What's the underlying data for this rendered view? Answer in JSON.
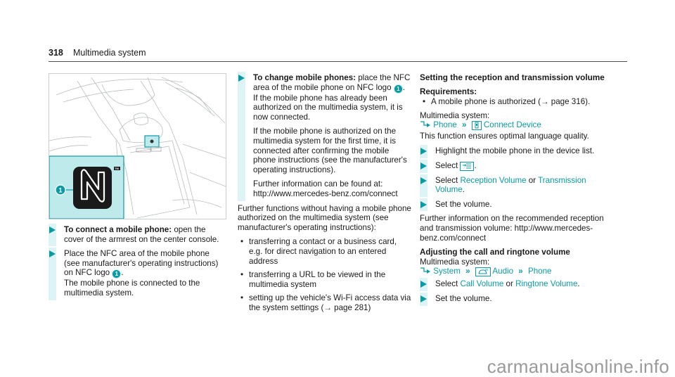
{
  "header": {
    "page_number": "318",
    "section_title": "Multimedia system"
  },
  "figure": {
    "callout_number": "1",
    "trademark": "TM",
    "logo_label": "NFC logo"
  },
  "col1": {
    "step1": {
      "bold": "To connect a mobile phone:",
      "text": " open the cover of the armrest on the center console."
    },
    "step2": {
      "text_a": "Place the NFC area of the mobile phone (see manufacturer's operating instructions) on NFC logo ",
      "callout": "1",
      "text_b": ".",
      "result": "The mobile phone is connected to the multimedia system."
    }
  },
  "col2": {
    "step1": {
      "bold": "To change mobile phones:",
      "text_a": " place the NFC area of the mobile phone on NFC logo ",
      "callout": "1",
      "text_b": ".",
      "para1": "If the mobile phone has already been authorized on the multimedia system, it is now connected.",
      "para2": "If the mobile phone is authorized on the multimedia system for the first time, it is connected after confirming the mobile phone instructions (see the manufacturer's operating instructions).",
      "para3": "Further information can be found at: http://www.mercedes-benz.com/connect"
    },
    "intro": "Further functions without having a mobile phone authorized on the multimedia system (see manufacturer's operating instructions):",
    "bullets": [
      "transferring a contact or a business card, e.g. for direct navigation to an entered address",
      "transferring a URL to be viewed in the multimedia system",
      "setting up the vehicle's Wi-Fi access data via the system settings (→ page 281)"
    ]
  },
  "col3": {
    "heading1": "Setting the reception and transmission volume",
    "requirements_label": "Requirements:",
    "requirements": [
      "A mobile phone is authorized (→ page 316)."
    ],
    "multimedia_label": "Multimedia system:",
    "path1": {
      "item1": "Phone",
      "sep": "»",
      "item2": "Connect Device"
    },
    "info": "This function ensures optimal language quality.",
    "steps1": [
      {
        "text": "Highlight the mobile phone in the device list."
      },
      {
        "text_a": "Select ",
        "text_b": "."
      },
      {
        "text_a": "Select ",
        "link1": "Reception Volume",
        "mid": " or ",
        "link2": "Transmission Volume",
        "text_b": "."
      },
      {
        "text": "Set the volume."
      }
    ],
    "further_info": "Further information on the recommended reception and transmission volume: http://www.mercedes-benz.com/connect",
    "heading2": "Adjusting the call and ringtone volume",
    "multimedia_label2": "Multimedia system:",
    "path2": {
      "item1": "System",
      "sep": "»",
      "item2": "Audio",
      "item3": "Phone"
    },
    "steps2": [
      {
        "text_a": "Select ",
        "link1": "Call Volume",
        "mid": " or ",
        "link2": "Ringtone Volume",
        "text_b": "."
      },
      {
        "text": "Set the volume."
      }
    ]
  },
  "watermark": "carmanualsonline.info",
  "colors": {
    "accent": "#0a9aa3",
    "step_bar": "#dcf4f6",
    "inset_bg": "#bfeaec"
  }
}
